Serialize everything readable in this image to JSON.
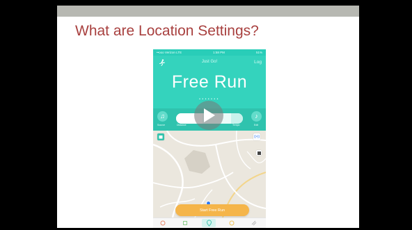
{
  "slide": {
    "title": "What are Location Settings?"
  },
  "phone": {
    "status": {
      "carrier": "••ooo Verizon LTE",
      "time": "1:58 PM",
      "battery": "51%"
    },
    "header": {
      "app_name": "Just Go!",
      "log_label": "Log",
      "run_title": "Free Run",
      "page_dots": "•••••••"
    },
    "controls": {
      "left_label": "Source",
      "left_mode_label": "Distance",
      "right_mode_label": "Tempo",
      "right_label": "Edit"
    },
    "start_button_label": "Start Free Run",
    "tabs": [
      "run-tab",
      "workouts-tab",
      "location-tab",
      "music-tab",
      "settings-tab"
    ]
  },
  "colors": {
    "teal": "#34d3bd",
    "title_red": "#a8403f",
    "start_orange": "#f5b54a"
  }
}
